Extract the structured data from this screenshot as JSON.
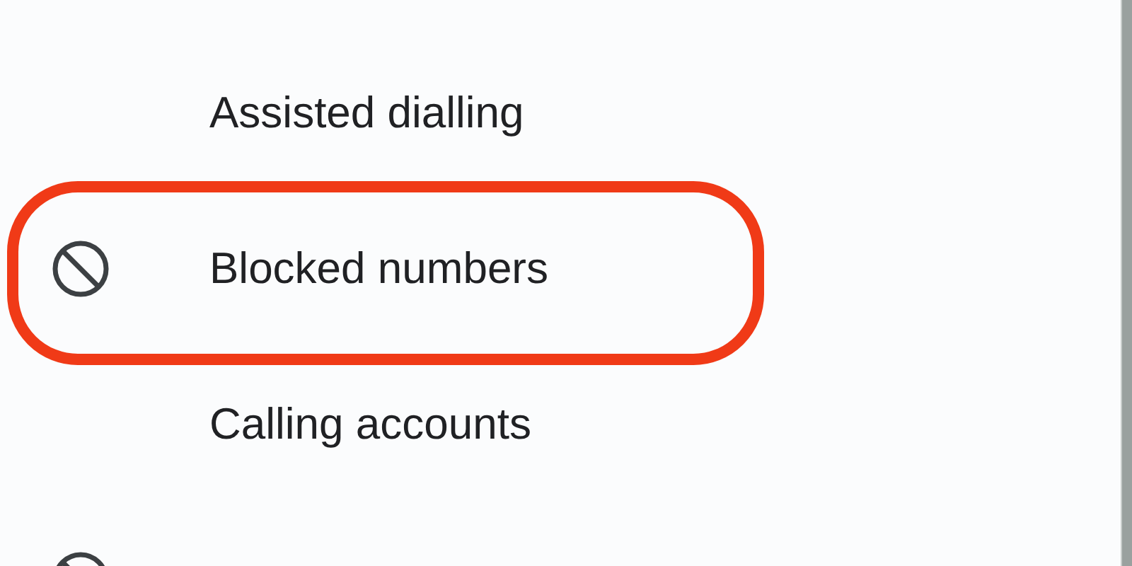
{
  "settings_items": [
    {
      "label": "Assisted dialling",
      "has_icon": false,
      "highlighted": false
    },
    {
      "label": "Blocked numbers",
      "has_icon": true,
      "highlighted": true
    },
    {
      "label": "Calling accounts",
      "has_icon": false,
      "highlighted": false
    },
    {
      "has_icon": true,
      "highlighted": false
    }
  ]
}
